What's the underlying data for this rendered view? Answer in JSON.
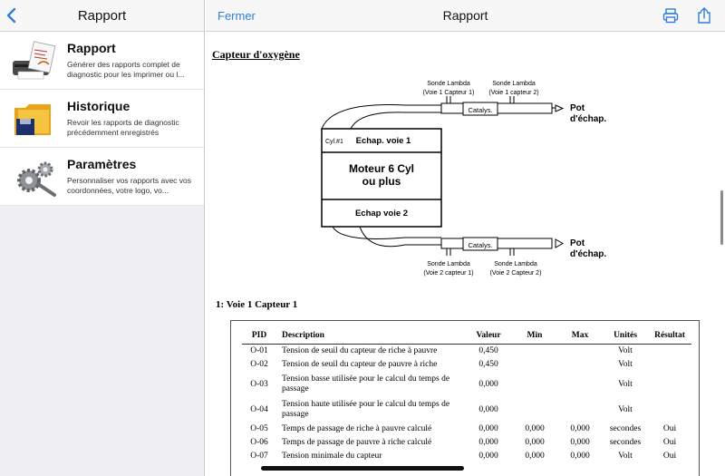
{
  "sidebar": {
    "title": "Rapport",
    "items": [
      {
        "title": "Rapport",
        "desc": "Générer des rapports complet de diagnostic pour les imprimer ou l...",
        "icon": "report-icon"
      },
      {
        "title": "Historique",
        "desc": "Revoir les rapports de diagnostic précédemment enregistrés",
        "icon": "folder-icon"
      },
      {
        "title": "Paramètres",
        "desc": "Personnaliser vos rapports avec vos coordonnées, votre logo, vo...",
        "icon": "gears-icon"
      }
    ]
  },
  "header": {
    "close_label": "Fermer",
    "title": "Rapport",
    "icons": [
      "printer-icon",
      "share-icon"
    ],
    "accent": "#2f7fdc"
  },
  "document": {
    "title": "Capteur d'oxygène",
    "diagram": {
      "sensor_top_left": [
        "Sonde Lambda",
        "(Voie 1 Capteur 1)"
      ],
      "sensor_top_right": [
        "Sonde Lambda",
        "(Voie 1 capteur 2)"
      ],
      "sensor_bottom_left": [
        "Sonde Lambda",
        "(Voie 2 capteur 1)"
      ],
      "sensor_bottom_right": [
        "Sonde Lambda",
        "(Voie 2 Capteur 2)"
      ],
      "catalyst": "Catalys.",
      "exhaust": [
        "Pot",
        "d'échap."
      ],
      "cyl_label": "Cyl.#1",
      "bank1": "Echap. voie 1",
      "engine": [
        "Moteur 6 Cyl",
        "ou plus"
      ],
      "bank2": "Echap voie 2"
    },
    "section": "1: Voie 1 Capteur 1",
    "table": {
      "headers": [
        "PID",
        "Description",
        "Valeur",
        "Min",
        "Max",
        "Unités",
        "Résultat"
      ],
      "rows": [
        {
          "pid": "O-01",
          "desc": "Tension de seuil du capteur de riche à pauvre",
          "val": "0,450",
          "min": "",
          "max": "",
          "unit": "Volt",
          "res": ""
        },
        {
          "pid": "O-02",
          "desc": "Tension de seuil du capteur de pauvre à riche",
          "val": "0,450",
          "min": "",
          "max": "",
          "unit": "Volt",
          "res": ""
        },
        {
          "pid": "O-03",
          "desc": "Tension basse utilisée pour le calcul du temps de passage",
          "val": "0,000",
          "min": "",
          "max": "",
          "unit": "Volt",
          "res": ""
        },
        {
          "pid": "O-04",
          "desc": "Tension haute utilisée pour le calcul du temps de passage",
          "val": "0,000",
          "min": "",
          "max": "",
          "unit": "Volt",
          "res": ""
        },
        {
          "pid": "O-05",
          "desc": "Temps de passage de riche à pauvre calculé",
          "val": "0,000",
          "min": "0,000",
          "max": "0,000",
          "unit": "secondes",
          "res": "Oui"
        },
        {
          "pid": "O-06",
          "desc": "Temps de passage de pauvre à riche calculé",
          "val": "0,000",
          "min": "0,000",
          "max": "0,000",
          "unit": "secondes",
          "res": "Oui"
        },
        {
          "pid": "O-07",
          "desc": "Tension minimale du capteur",
          "val": "0,000",
          "min": "0,000",
          "max": "0,000",
          "unit": "Volt",
          "res": "Oui"
        }
      ]
    }
  }
}
